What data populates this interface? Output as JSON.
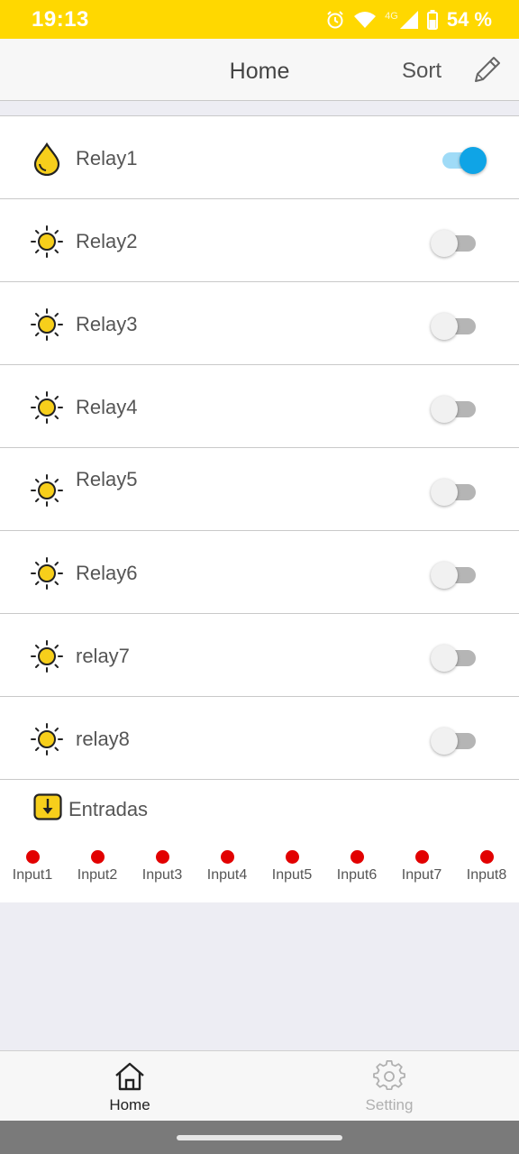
{
  "status_bar": {
    "time": "19:13",
    "network": "4G",
    "battery": "54 %",
    "icons": [
      "alarm-icon",
      "wifi-icon",
      "signal-icon",
      "battery-icon"
    ]
  },
  "header": {
    "title": "Home",
    "sort_label": "Sort",
    "edit_icon": "pencil-icon"
  },
  "relays": [
    {
      "label": "Relay1",
      "icon": "water-drop-icon",
      "on": true
    },
    {
      "label": "Relay2",
      "icon": "sun-icon",
      "on": false
    },
    {
      "label": "Relay3",
      "icon": "sun-icon",
      "on": false
    },
    {
      "label": "Relay4",
      "icon": "sun-icon",
      "on": false
    },
    {
      "label": "Relay5",
      "icon": "sun-icon",
      "on": false
    },
    {
      "label": "Relay6",
      "icon": "sun-icon",
      "on": false
    },
    {
      "label": "relay7",
      "icon": "sun-icon",
      "on": false
    },
    {
      "label": "relay8",
      "icon": "sun-icon",
      "on": false
    }
  ],
  "inputs": {
    "title": "Entradas",
    "icon": "arrow-down-box-icon",
    "items": [
      {
        "label": "Input1",
        "state_color": "#e20000"
      },
      {
        "label": "Input2",
        "state_color": "#e20000"
      },
      {
        "label": "Input3",
        "state_color": "#e20000"
      },
      {
        "label": "Input4",
        "state_color": "#e20000"
      },
      {
        "label": "Input5",
        "state_color": "#e20000"
      },
      {
        "label": "Input6",
        "state_color": "#e20000"
      },
      {
        "label": "Input7",
        "state_color": "#e20000"
      },
      {
        "label": "Input8",
        "state_color": "#e20000"
      }
    ]
  },
  "tabs": [
    {
      "label": "Home",
      "icon": "home-icon",
      "active": true
    },
    {
      "label": "Setting",
      "icon": "gear-icon",
      "active": false
    }
  ],
  "colors": {
    "accent": "#ffd800",
    "toggle_on": "#0fa4e6",
    "input_off": "#e20000"
  }
}
